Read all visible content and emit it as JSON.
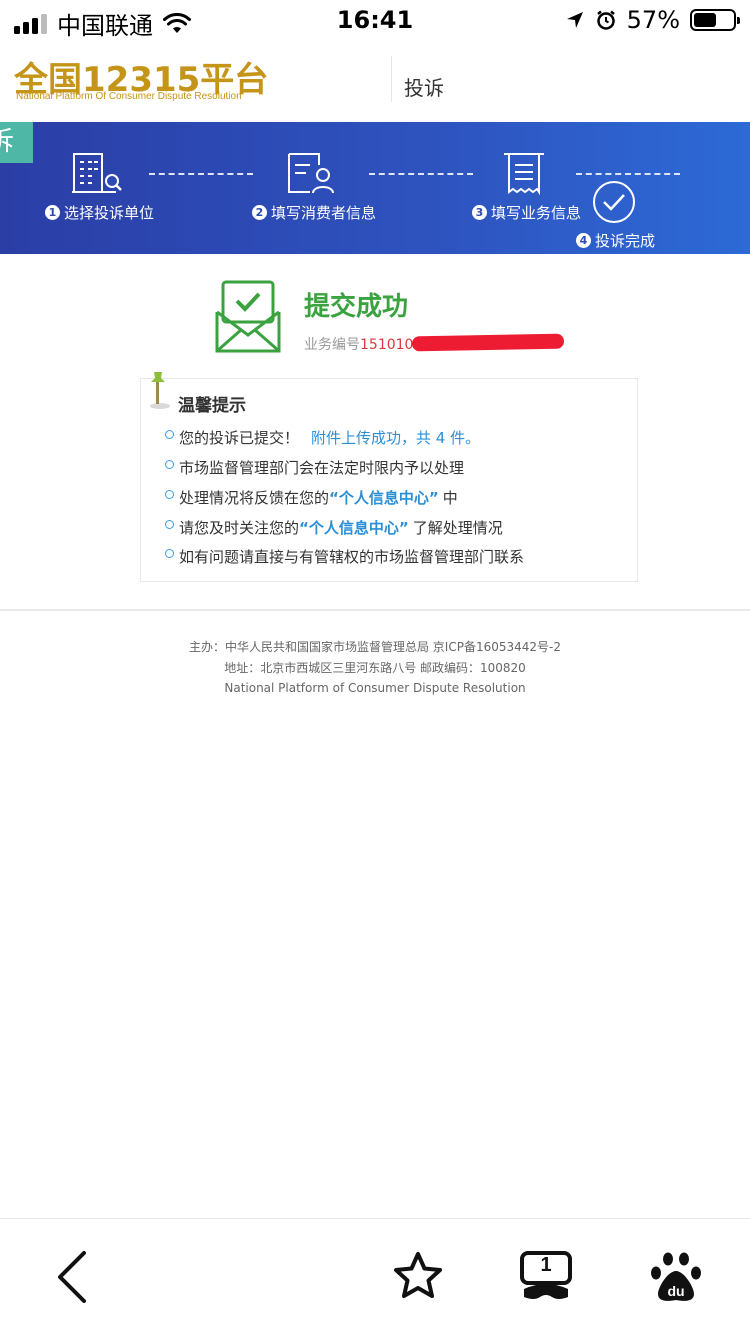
{
  "status_bar": {
    "carrier": "中国联通",
    "time": "16:41",
    "battery_percent": "57%",
    "battery_level": 0.57,
    "icons": [
      "signal-icon",
      "wifi-icon",
      "location-arrow-icon",
      "alarm-icon",
      "battery-icon"
    ]
  },
  "header": {
    "logo_title": "全国12315平台",
    "logo_subtitle": "National Platform Of Consumer Dispute Resolution",
    "section": "投诉"
  },
  "steps": {
    "badge": "诉",
    "items": [
      {
        "num": "1",
        "label": "选择投诉单位",
        "icon": "building-search-icon"
      },
      {
        "num": "2",
        "label": "填写消费者信息",
        "icon": "user-card-icon"
      },
      {
        "num": "3",
        "label": "填写业务信息",
        "icon": "document-icon"
      },
      {
        "num": "4",
        "label": "投诉完成",
        "icon": "check-circle-icon"
      }
    ]
  },
  "result": {
    "title": "提交成功",
    "biz_label": "业务编号",
    "biz_number": "151010",
    "icon": "envelope-check-icon"
  },
  "tips": {
    "title": "温馨提示",
    "icon": "pin-icon",
    "items": [
      {
        "pre": "您的投诉已提交！",
        "hl": "附件上传成功，共 4 件。",
        "post": ""
      },
      {
        "pre": "市场监督管理部门会在法定时限内予以处理",
        "hl": "",
        "post": ""
      },
      {
        "pre": "处理情况将反馈在您的",
        "hl": "“个人信息中心”",
        "post": "中"
      },
      {
        "pre": "请您及时关注您的",
        "hl": "“个人信息中心”",
        "post": "了解处理情况"
      },
      {
        "pre": "如有问题请直接与有管辖权的市场监督管理部门联系",
        "hl": "",
        "post": ""
      }
    ]
  },
  "footer": {
    "line1": "主办：中华人民共和国国家市场监督管理总局 京ICP备16053442号-2",
    "line2": "地址：北京市西城区三里河东路八号 邮政编码：100820",
    "line3": "National Platform of Consumer Dispute Resolution"
  },
  "toolbar": {
    "tab_count": "1",
    "buttons": [
      "back-icon",
      "star-icon",
      "tabs-icon",
      "baidu-paw-icon"
    ]
  }
}
